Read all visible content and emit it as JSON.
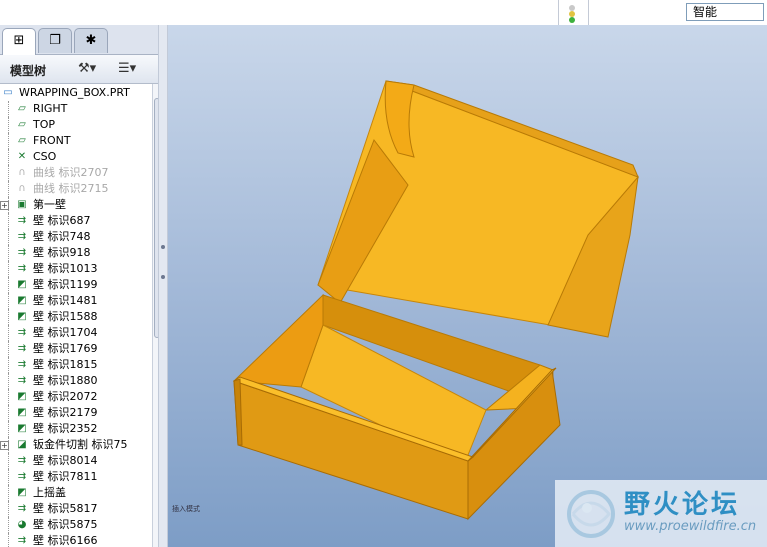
{
  "toolbar": {
    "filter_value": "智能"
  },
  "left_tabs": [
    {
      "name": "tab-model-tree",
      "glyph": "⊞"
    },
    {
      "name": "tab-layers",
      "glyph": "❐"
    },
    {
      "name": "tab-favorites",
      "glyph": "✱"
    }
  ],
  "tree_header": {
    "title": "模型树",
    "tools_glyph": "⚒▾",
    "settings_glyph": "☰▾"
  },
  "tree": [
    {
      "text": "WRAPPING_BOX.PRT",
      "icon": "part-icon",
      "glyph": "▭",
      "indent": 0,
      "dim": false,
      "expander": false
    },
    {
      "text": "RIGHT",
      "icon": "datum-plane-icon",
      "glyph": "▱",
      "indent": 1,
      "dim": false,
      "expander": false
    },
    {
      "text": "TOP",
      "icon": "datum-plane-icon",
      "glyph": "▱",
      "indent": 1,
      "dim": false,
      "expander": false
    },
    {
      "text": "FRONT",
      "icon": "datum-plane-icon",
      "glyph": "▱",
      "indent": 1,
      "dim": false,
      "expander": false
    },
    {
      "text": "CSO",
      "icon": "coordinate-system-icon",
      "glyph": "✕",
      "indent": 1,
      "dim": false,
      "expander": false
    },
    {
      "text": "曲线 标识2707",
      "icon": "curve-icon",
      "glyph": "∩",
      "indent": 1,
      "dim": true,
      "expander": false
    },
    {
      "text": "曲线 标识2715",
      "icon": "curve-icon",
      "glyph": "∩",
      "indent": 1,
      "dim": true,
      "expander": false
    },
    {
      "text": "第一壁",
      "icon": "first-wall-icon",
      "glyph": "▣",
      "indent": 1,
      "dim": false,
      "expander": true
    },
    {
      "text": "壁 标识687",
      "icon": "flat-wall-icon",
      "glyph": "⇉",
      "indent": 1,
      "dim": false,
      "expander": false
    },
    {
      "text": "壁 标识748",
      "icon": "flat-wall-icon",
      "glyph": "⇉",
      "indent": 1,
      "dim": false,
      "expander": false
    },
    {
      "text": "壁 标识918",
      "icon": "flat-wall-icon",
      "glyph": "⇉",
      "indent": 1,
      "dim": false,
      "expander": false
    },
    {
      "text": "壁 标识1013",
      "icon": "flat-wall-icon",
      "glyph": "⇉",
      "indent": 1,
      "dim": false,
      "expander": false
    },
    {
      "text": "壁 标识1199",
      "icon": "flange-wall-icon",
      "glyph": "◩",
      "indent": 1,
      "dim": false,
      "expander": false
    },
    {
      "text": "壁 标识1481",
      "icon": "flange-wall-icon",
      "glyph": "◩",
      "indent": 1,
      "dim": false,
      "expander": false
    },
    {
      "text": "壁 标识1588",
      "icon": "flange-wall-icon",
      "glyph": "◩",
      "indent": 1,
      "dim": false,
      "expander": false
    },
    {
      "text": "壁 标识1704",
      "icon": "flat-wall-icon",
      "glyph": "⇉",
      "indent": 1,
      "dim": false,
      "expander": false
    },
    {
      "text": "壁 标识1769",
      "icon": "flat-wall-icon",
      "glyph": "⇉",
      "indent": 1,
      "dim": false,
      "expander": false
    },
    {
      "text": "壁 标识1815",
      "icon": "flat-wall-icon",
      "glyph": "⇉",
      "indent": 1,
      "dim": false,
      "expander": false
    },
    {
      "text": "壁 标识1880",
      "icon": "flat-wall-icon",
      "glyph": "⇉",
      "indent": 1,
      "dim": false,
      "expander": false
    },
    {
      "text": "壁 标识2072",
      "icon": "flange-wall-icon",
      "glyph": "◩",
      "indent": 1,
      "dim": false,
      "expander": false
    },
    {
      "text": "壁 标识2179",
      "icon": "flange-wall-icon",
      "glyph": "◩",
      "indent": 1,
      "dim": false,
      "expander": false
    },
    {
      "text": "壁 标识2352",
      "icon": "flange-wall-icon",
      "glyph": "◩",
      "indent": 1,
      "dim": false,
      "expander": false
    },
    {
      "text": "钣金件切割 标识75",
      "icon": "sheetmetal-cut-icon",
      "glyph": "◪",
      "indent": 1,
      "dim": false,
      "expander": true
    },
    {
      "text": "壁 标识8014",
      "icon": "flat-wall-icon",
      "glyph": "⇉",
      "indent": 1,
      "dim": false,
      "expander": false
    },
    {
      "text": "壁 标识7811",
      "icon": "flat-wall-icon",
      "glyph": "⇉",
      "indent": 1,
      "dim": false,
      "expander": false
    },
    {
      "text": "上摇盖",
      "icon": "lid-icon",
      "glyph": "◩",
      "indent": 1,
      "dim": false,
      "expander": false
    },
    {
      "text": "壁 标识5817",
      "icon": "flat-wall-icon",
      "glyph": "⇉",
      "indent": 1,
      "dim": false,
      "expander": false
    },
    {
      "text": "壁 标识5875",
      "icon": "bend-wall-icon",
      "glyph": "◕",
      "indent": 1,
      "dim": false,
      "expander": false
    },
    {
      "text": "壁 标识6166",
      "icon": "flat-wall-icon",
      "glyph": "⇉",
      "indent": 1,
      "dim": false,
      "expander": false
    }
  ],
  "viewport": {
    "orientation_label": "插入模式"
  },
  "watermark": {
    "cn": "野火论坛",
    "url": "www.proewildfire.cn"
  },
  "colors": {
    "box_front": "#e09a14",
    "box_side": "#f0ae1c",
    "box_inner": "#f7b824",
    "box_dark": "#b87a06",
    "box_top": "#fbbf2a"
  }
}
